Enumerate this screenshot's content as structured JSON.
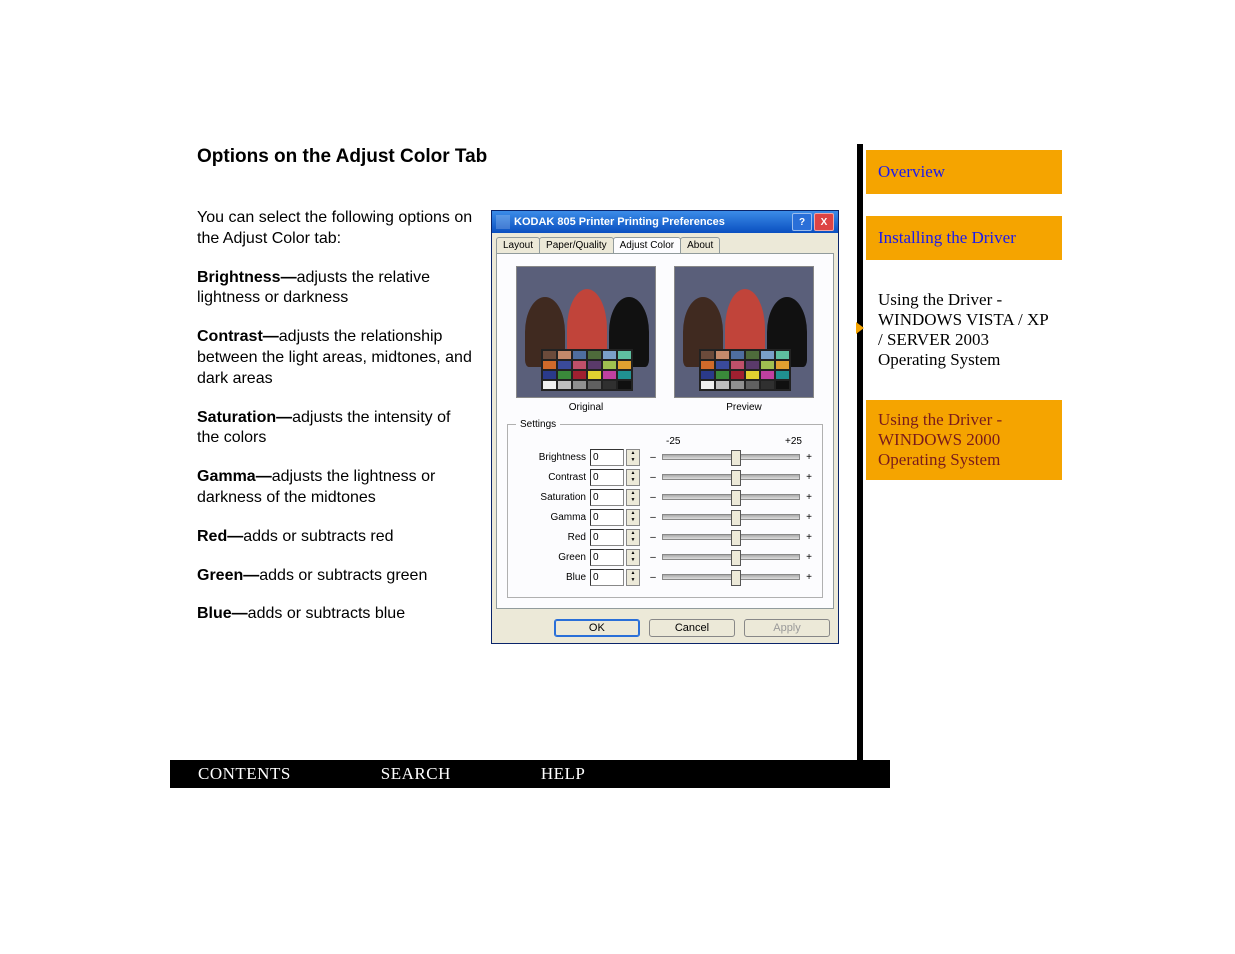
{
  "heading": "Options on the Adjust Color Tab",
  "intro": "You can select the following options on the Adjust Color tab:",
  "options": {
    "brightness_b": "Brightness—",
    "brightness_t": "adjusts the relative lightness or darkness",
    "contrast_b": "Contrast—",
    "contrast_t": "adjusts the relationship between the light areas, midtones, and dark areas",
    "saturation_b": "Saturation—",
    "saturation_t": "adjusts the intensity of the colors",
    "gamma_b": "Gamma—",
    "gamma_t": "adjusts the lightness or darkness of the midtones",
    "red_b": "Red—",
    "red_t": "adds or subtracts red",
    "green_b": "Green—",
    "green_t": "adds or subtracts green",
    "blue_b": "Blue—",
    "blue_t": "adds or subtracts blue"
  },
  "dialog": {
    "title": "KODAK 805 Printer Printing Preferences",
    "help_icon": "?",
    "close_icon": "X",
    "tabs": {
      "layout": "Layout",
      "paper": "Paper/Quality",
      "adjust": "Adjust Color",
      "about": "About"
    },
    "original_lbl": "Original",
    "preview_lbl": "Preview",
    "settings_legend": "Settings",
    "scale_neg": "-25",
    "scale_pos": "+25",
    "sliders": {
      "brightness": {
        "label": "Brightness",
        "underline": "B",
        "value": "0"
      },
      "contrast": {
        "label": "Contrast",
        "underline": "C",
        "value": "0"
      },
      "saturation": {
        "label": "Saturation",
        "underline": "S",
        "value": "0"
      },
      "gamma": {
        "label": "Gamma",
        "underline": "G",
        "value": "0"
      },
      "red": {
        "label": "Red",
        "underline": "R",
        "value": "0"
      },
      "green": {
        "label": "Green",
        "underline": "G",
        "value": "0"
      },
      "blue": {
        "label": "Blue",
        "underline": "B",
        "value": "0"
      }
    },
    "minus": "–",
    "plus": "+",
    "btn_ok": "OK",
    "btn_cancel": "Cancel",
    "btn_apply": "Apply"
  },
  "nav": {
    "overview": "Overview",
    "installing": "Installing the Driver",
    "using_vista": "Using the Driver - WINDOWS VISTA / XP / SERVER 2003 Operating System",
    "using_2000": "Using the Driver - WINDOWS 2000 Operating System"
  },
  "bottombar": {
    "contents": "CONTENTS",
    "search": "SEARCH",
    "help": "HELP"
  },
  "swatches": [
    "#6b4b3b",
    "#c48a6b",
    "#4f6ea0",
    "#4e6b3b",
    "#7aa0c8",
    "#5fc0a0",
    "#d06a2a",
    "#3a4a9a",
    "#c0506a",
    "#5a3a6a",
    "#a0c050",
    "#e0a030",
    "#2a3a8a",
    "#3a8a3a",
    "#a02030",
    "#e0d030",
    "#c040a0",
    "#209090",
    "#f0f0f0",
    "#c0c0c0",
    "#909090",
    "#606060",
    "#303030",
    "#101010"
  ]
}
